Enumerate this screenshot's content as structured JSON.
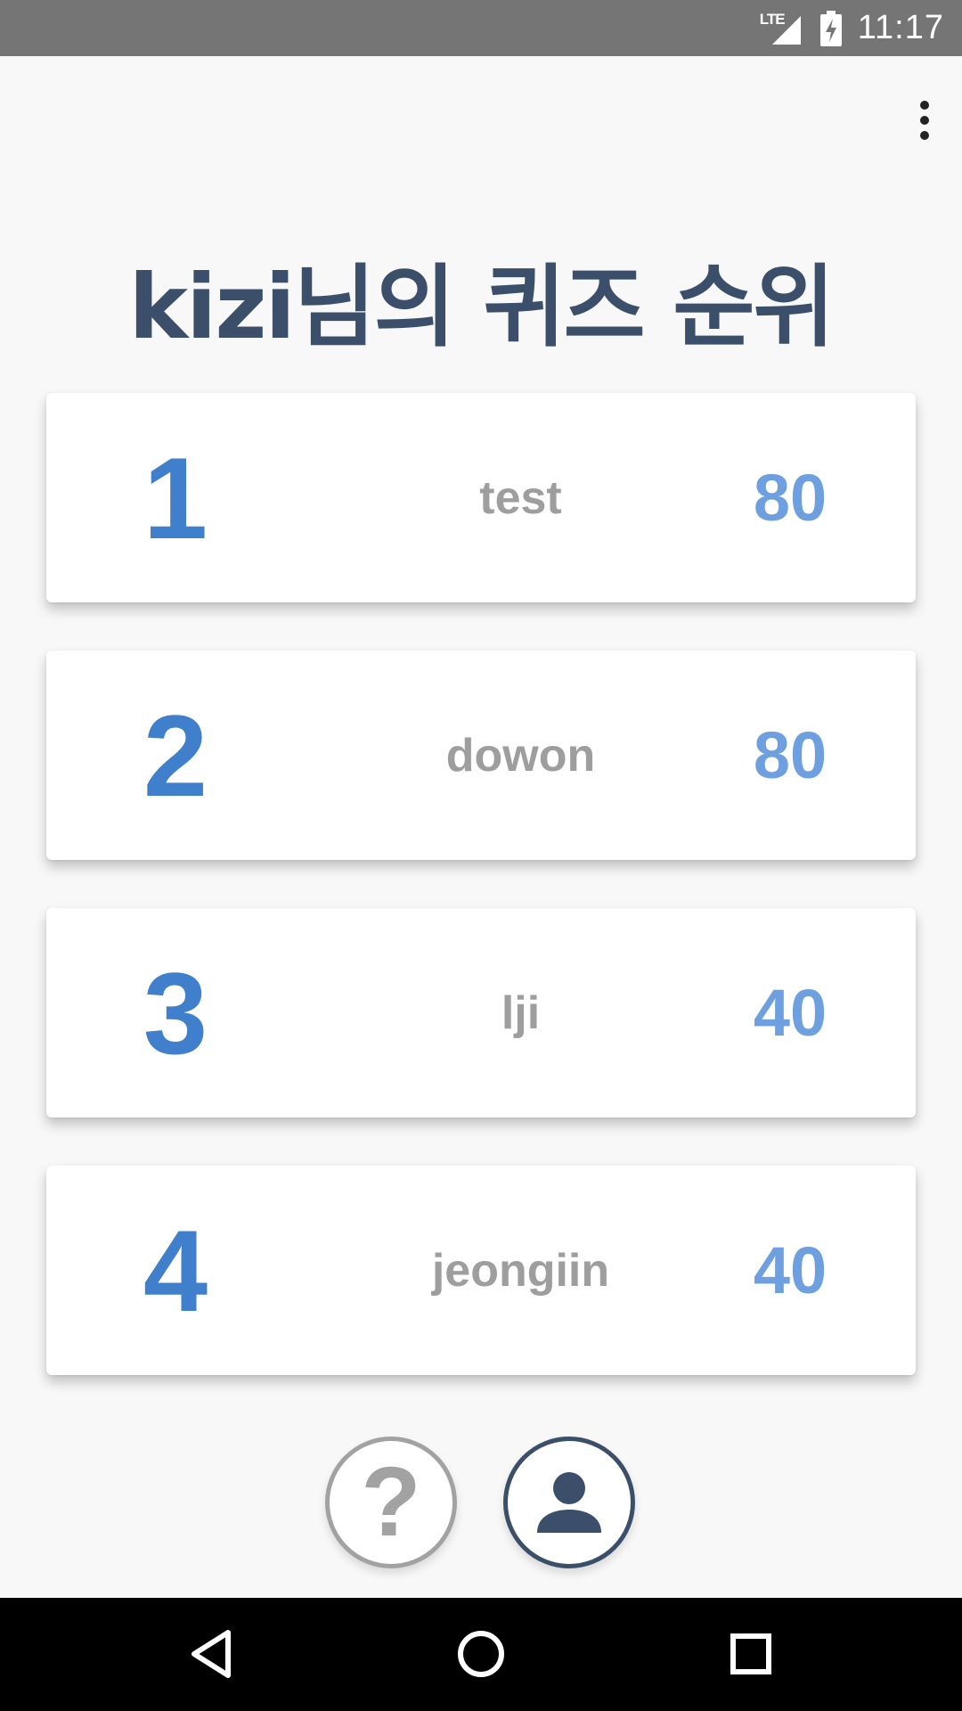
{
  "status_bar": {
    "network": "LTE",
    "time": "11:17"
  },
  "page": {
    "title": "kizi님의 퀴즈 순위"
  },
  "rankings": [
    {
      "rank": "1",
      "name": "test",
      "score": "80"
    },
    {
      "rank": "2",
      "name": "dowon",
      "score": "80"
    },
    {
      "rank": "3",
      "name": "lji",
      "score": "40"
    },
    {
      "rank": "4",
      "name": "jeongiin",
      "score": "40"
    }
  ],
  "actions": {
    "help_icon": "question-icon",
    "profile_icon": "person-icon"
  },
  "colors": {
    "title": "#3b4f6b",
    "rank_number": "#3f7fcc",
    "score": "#6ea0e0",
    "name": "#9e9e9e"
  }
}
